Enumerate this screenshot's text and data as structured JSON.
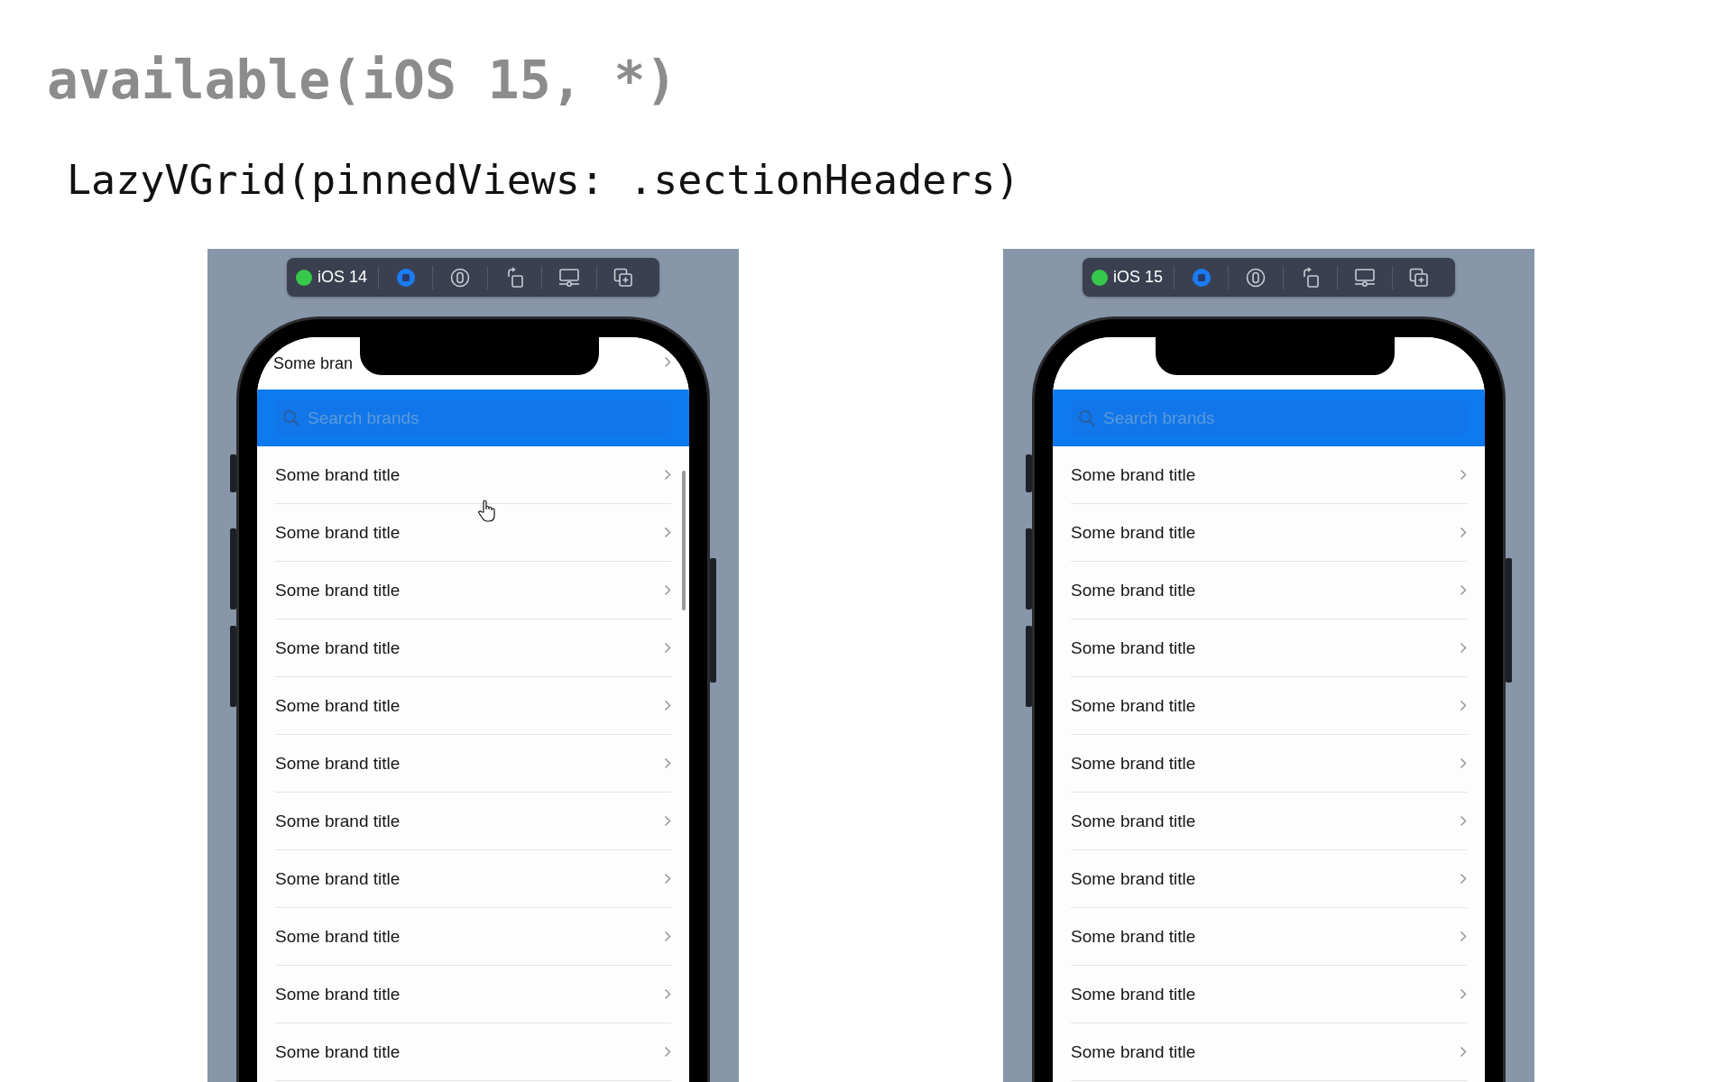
{
  "title": "available(iOS 15, *)",
  "subtitle": "LazyVGrid(pinnedViews: .sectionHeaders)",
  "simulators": [
    {
      "os_label": "iOS 14",
      "running": true,
      "peek_row": "Some bran",
      "search": {
        "placeholder": "Search brands"
      },
      "scroll_indicator": true,
      "cursor": true,
      "rows": [
        "Some brand title",
        "Some brand title",
        "Some brand title",
        "Some brand title",
        "Some brand title",
        "Some brand title",
        "Some brand title",
        "Some brand title",
        "Some brand title",
        "Some brand title",
        "Some brand title"
      ]
    },
    {
      "os_label": "iOS 15",
      "running": true,
      "search": {
        "placeholder": "Search brands"
      },
      "scroll_indicator": false,
      "cursor": false,
      "rows": [
        "Some brand title",
        "Some brand title",
        "Some brand title",
        "Some brand title",
        "Some brand title",
        "Some brand title",
        "Some brand title",
        "Some brand title",
        "Some brand title",
        "Some brand title",
        "Some brand title"
      ]
    }
  ]
}
